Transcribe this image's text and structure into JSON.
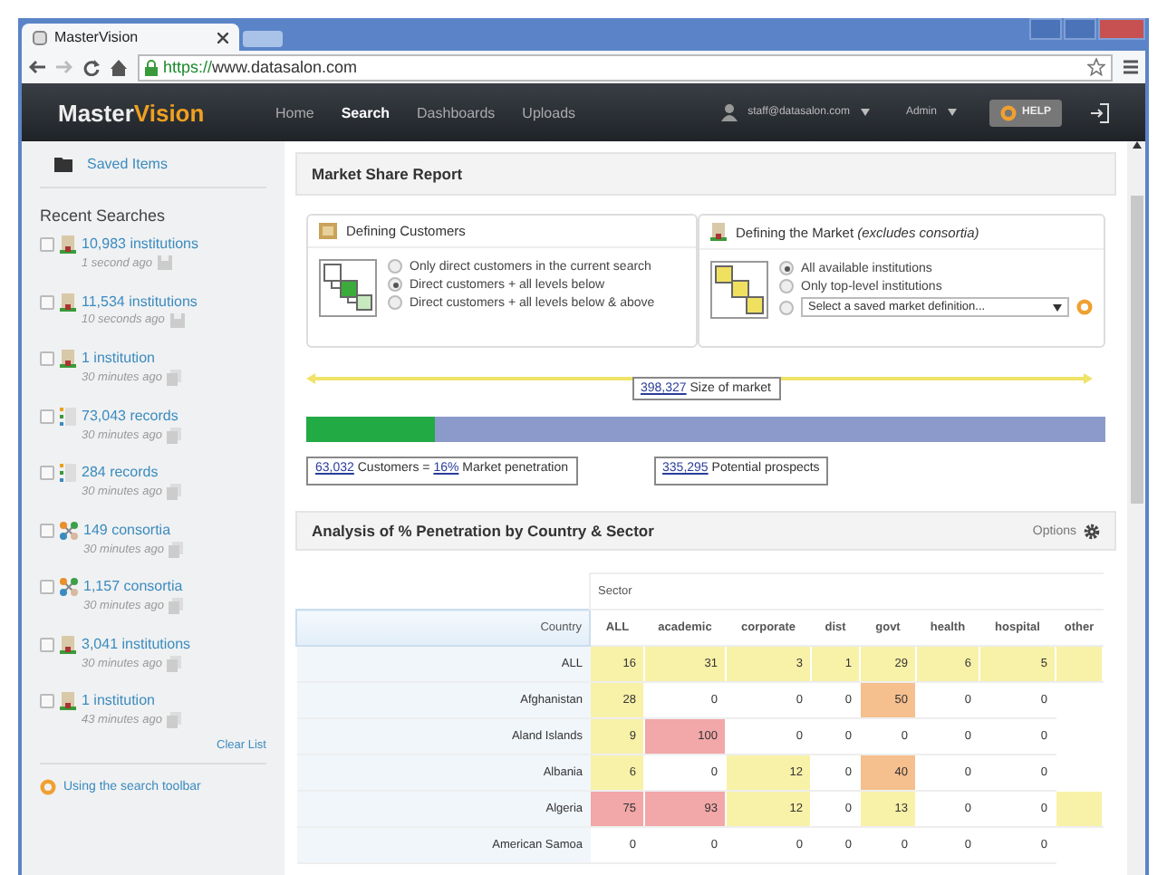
{
  "browser": {
    "tab_title": "MasterVision",
    "url_scheme": "https://",
    "url_host": "www.datasalon.com"
  },
  "app_bar": {
    "logo_first": "Master",
    "logo_second": "Vision",
    "nav": [
      {
        "label": "Home",
        "selected": false
      },
      {
        "label": "Search",
        "selected": true
      },
      {
        "label": "Dashboards",
        "selected": false
      },
      {
        "label": "Uploads",
        "selected": false
      }
    ],
    "user": "staff@datasalon.com",
    "admin": "Admin",
    "help": "HELP"
  },
  "sidebar": {
    "saved_items": "Saved Items",
    "recent_title": "Recent Searches",
    "items": [
      {
        "kind": "institution",
        "label": "10,983 institutions",
        "time": "1 second ago",
        "action": {
          "kind": "save"
        },
        "checked": false
      },
      {
        "kind": "institution",
        "label": "11,534 institutions",
        "time": "10 seconds ago",
        "action": {
          "kind": "save"
        },
        "checked": false
      },
      {
        "kind": "institution",
        "label": "1 institution",
        "time": "30 minutes ago",
        "action": {
          "kind": "copy"
        },
        "checked": false
      },
      {
        "kind": "records",
        "label": "73,043 records",
        "time": "30 minutes ago",
        "action": {
          "kind": "copy"
        },
        "checked": false
      },
      {
        "kind": "records",
        "label": "284 records",
        "time": "30 minutes ago",
        "action": {
          "kind": "copy"
        },
        "checked": false
      },
      {
        "kind": "consortia",
        "label": "149 consortia",
        "time": "30 minutes ago",
        "action": {
          "kind": "copy"
        },
        "checked": false
      },
      {
        "kind": "consortia",
        "label": "1,157 consortia",
        "time": "30 minutes ago",
        "action": {
          "kind": "copy"
        },
        "checked": false
      },
      {
        "kind": "institution",
        "label": "3,041 institutions",
        "time": "30 minutes ago",
        "action": {
          "kind": "copy"
        },
        "checked": false
      },
      {
        "kind": "institution",
        "label": "1 institution",
        "time": "43 minutes ago",
        "action": {
          "kind": "copy"
        },
        "checked": false
      }
    ],
    "clear": "Clear List",
    "help_link": "Using the search toolbar"
  },
  "report": {
    "title": "Market Share Report",
    "customers_box": {
      "title": "Defining Customers",
      "options": [
        {
          "label": "Only direct customers in the current search",
          "selected": false
        },
        {
          "label": "Direct customers + all levels below",
          "selected": true
        },
        {
          "label": "Direct customers + all levels below & above",
          "selected": false
        }
      ]
    },
    "market_box": {
      "title": "Defining the Market ",
      "title_note": "(excludes consortia)",
      "options": [
        {
          "label": "All available institutions",
          "selected": true
        },
        {
          "label": "Only top-level institutions",
          "selected": false
        }
      ],
      "select_option": {
        "selected": false,
        "placeholder": "Select a saved market definition..."
      }
    },
    "market_size": {
      "number": "398,327",
      "label": " Size of market"
    },
    "penetration": {
      "level": 0.16
    },
    "customers": {
      "number": "63,032",
      "label": " Customers = ",
      "percent": "16%",
      "suffix": " Market penetration"
    },
    "prospects": {
      "number": "335,295",
      "label": " Potential prospects"
    }
  },
  "analysis": {
    "title": "Analysis of % Penetration by Country & Sector",
    "options": "Options",
    "group_header": "Sector",
    "columns": [
      "Country",
      "ALL",
      "academic",
      "corporate",
      "dist",
      "govt",
      "health",
      "hospital",
      "other"
    ],
    "rows": [
      {
        "cells": [
          {
            "value": "ALL"
          },
          {
            "value": "16",
            "color": "#f8f1a8"
          },
          {
            "value": "31",
            "color": "#f8f1a8"
          },
          {
            "value": "3",
            "color": "#f8f1a8"
          },
          {
            "value": "1",
            "color": "#f8f1a8"
          },
          {
            "value": "29",
            "color": "#f8f1a8"
          },
          {
            "value": "6",
            "color": "#f8f1a8"
          },
          {
            "value": "5",
            "color": "#f8f1a8"
          },
          {
            "color": "#f8f1a8"
          }
        ]
      },
      {
        "cells": [
          {
            "value": "Afghanistan"
          },
          {
            "value": "28",
            "color": "#f8f1a8"
          },
          {
            "value": "0"
          },
          {
            "value": "0"
          },
          {
            "value": "0"
          },
          {
            "value": "50",
            "color": "#f5bf8e"
          },
          {
            "value": "0"
          },
          {
            "value": "0"
          }
        ]
      },
      {
        "cells": [
          {
            "value": "Aland Islands"
          },
          {
            "value": "9",
            "color": "#f8f1a8"
          },
          {
            "value": "100",
            "color": "#f2a7a8"
          },
          {
            "value": "0"
          },
          {
            "value": "0"
          },
          {
            "value": "0"
          },
          {
            "value": "0"
          },
          {
            "value": "0"
          }
        ]
      },
      {
        "cells": [
          {
            "value": "Albania"
          },
          {
            "value": "6",
            "color": "#f8f1a8"
          },
          {
            "value": "0"
          },
          {
            "value": "12",
            "color": "#f8f1a8"
          },
          {
            "value": "0"
          },
          {
            "value": "40",
            "color": "#f5bf8e"
          },
          {
            "value": "0"
          },
          {
            "value": "0"
          }
        ]
      },
      {
        "cells": [
          {
            "value": "Algeria"
          },
          {
            "value": "75",
            "color": "#f2a7a8"
          },
          {
            "value": "93",
            "color": "#f2a7a8"
          },
          {
            "value": "12",
            "color": "#f8f1a8"
          },
          {
            "value": "0"
          },
          {
            "value": "13",
            "color": "#f8f1a8"
          },
          {
            "value": "0"
          },
          {
            "value": "0"
          },
          {
            "color": "#f8f1a8"
          }
        ]
      },
      {
        "cells": [
          {
            "value": "American Samoa"
          },
          {
            "value": "0"
          },
          {
            "value": "0"
          },
          {
            "value": "0"
          },
          {
            "value": "0"
          },
          {
            "value": "0"
          },
          {
            "value": "0"
          },
          {
            "value": "0"
          }
        ]
      }
    ]
  }
}
